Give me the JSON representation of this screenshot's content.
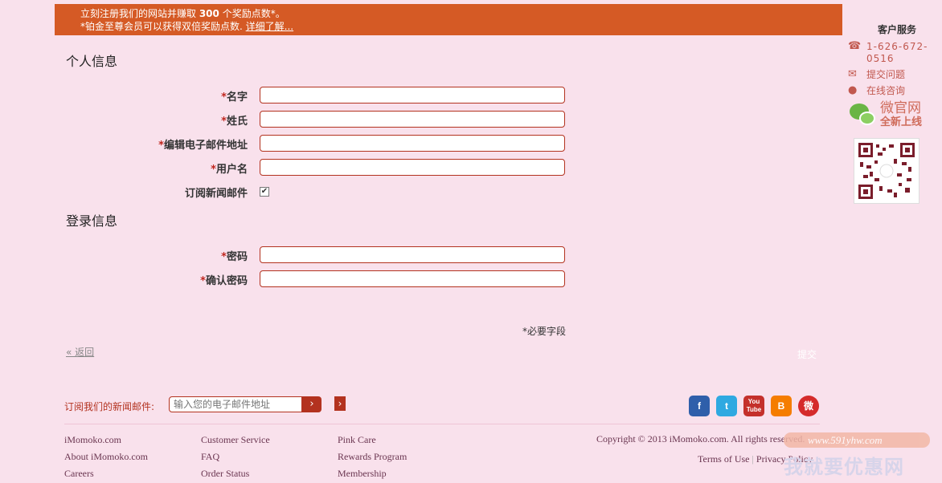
{
  "banner": {
    "line1_pre": "立刻注册我们的网站并赚取 ",
    "line1_points": "300",
    "line1_post": " 个奖励点数*。",
    "line2_pre": "*铂金至尊会员可以获得双倍奖励点数.",
    "line2_link": "详细了解..."
  },
  "personal": {
    "title": "个人信息",
    "required_mark": "*",
    "first_name_label": "名字",
    "last_name_label": "姓氏",
    "email_label": "编辑电子邮件地址",
    "username_label": "用户名",
    "newsletter_label": "订阅新闻邮件",
    "newsletter_checked": "✔"
  },
  "login": {
    "title": "登录信息",
    "password_label": "密码",
    "confirm_label": "确认密码"
  },
  "form": {
    "required_note": "*必要字段",
    "back_label": "« 返回",
    "submit_label": "提交"
  },
  "sidebar": {
    "title": "客户服务",
    "phone": "1-626-672-0516",
    "ticket": "提交问题",
    "chat": "在线咨询",
    "wechat_title": "微官网",
    "wechat_sub": "全新上线",
    "icons": [
      "phone-icon",
      "mail-icon",
      "chat-icon",
      "wechat-icon",
      "qr-code"
    ]
  },
  "footer": {
    "newsletter_label": "订阅我们的新闻邮件:",
    "newsletter_placeholder": "输入您的电子邮件地址",
    "go_label": "›",
    "socials": [
      "f",
      "t",
      "You Tube",
      "B",
      "微"
    ],
    "col1": [
      "iMomoko.com",
      "About iMomoko.com",
      "Careers"
    ],
    "col2": [
      "Customer Service",
      "FAQ",
      "Order Status"
    ],
    "col3": [
      "Pink Care",
      "Rewards Program",
      "Membership"
    ],
    "copyright": "Copyright © 2013 iMomoko.com. All rights reserved.",
    "terms": "Terms of Use",
    "terms_sep": "|",
    "privacy": "Privacy Policy"
  },
  "watermark": {
    "url": "www.591yhw.com",
    "text": "我就要优惠网"
  },
  "colors": {
    "background": "#f9e1ec",
    "banner": "#d55a25",
    "accent": "#b3321f"
  }
}
